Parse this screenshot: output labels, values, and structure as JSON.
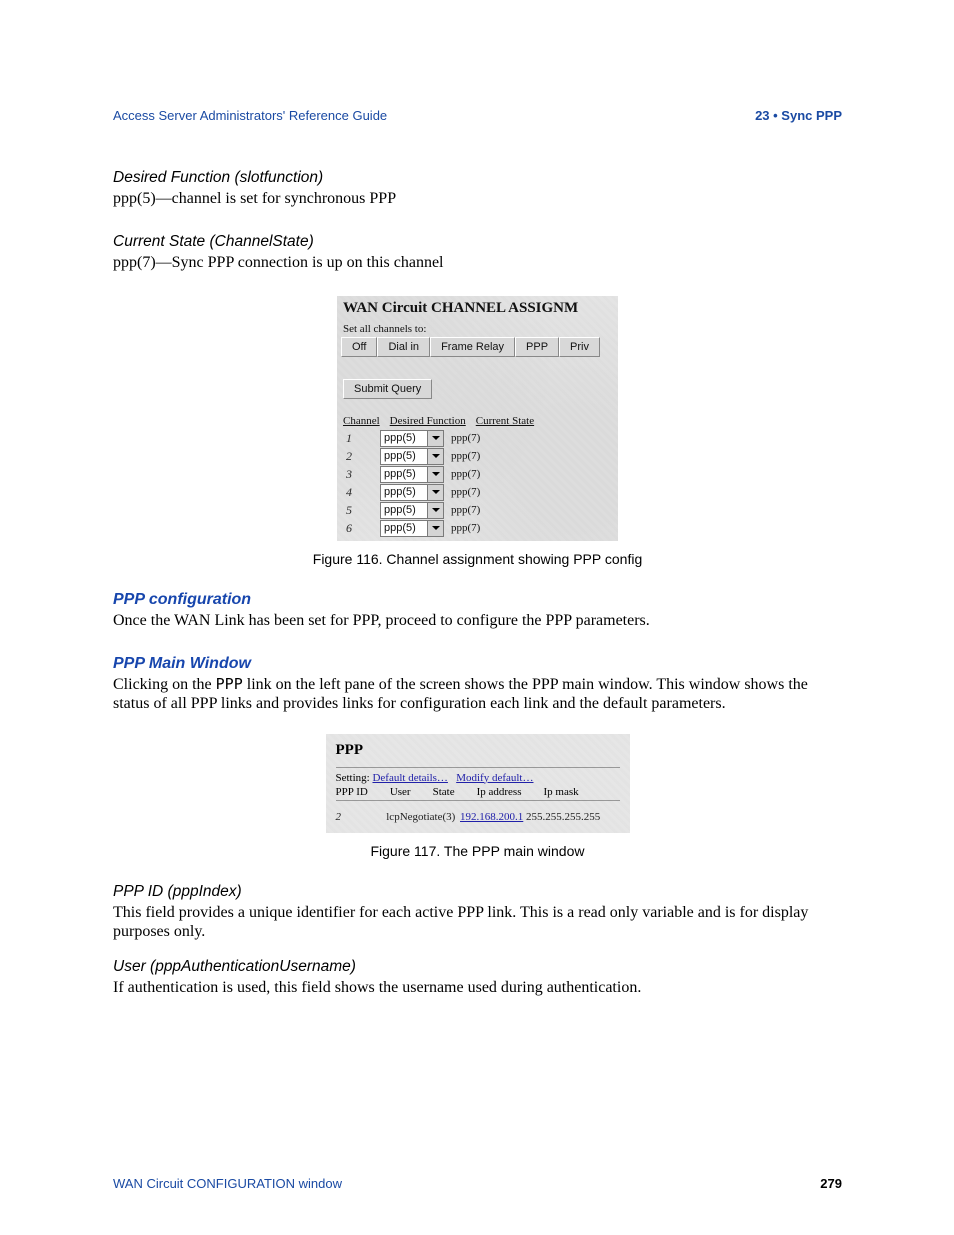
{
  "header": {
    "doc_title": "Access Server Administrators' Reference Guide",
    "chapter": "23 • Sync PPP"
  },
  "sec1": {
    "heading": "Desired Function (slotfunction)",
    "body": "ppp(5)—channel is set for synchronous PPP"
  },
  "sec2": {
    "heading": "Current State (ChannelState)",
    "body": "ppp(7)—Sync PPP connection is up on this channel"
  },
  "fig116": {
    "title": "WAN Circuit CHANNEL ASSIGNM",
    "set_label": "Set all channels to:",
    "buttons": [
      "Off",
      "Dial in",
      "Frame Relay",
      "PPP",
      "Priv"
    ],
    "submit": "Submit Query",
    "hdr": [
      "Channel",
      "Desired Function",
      "Current State"
    ],
    "rows": [
      {
        "ch": "1",
        "fn": "ppp(5)",
        "state": "ppp(7)"
      },
      {
        "ch": "2",
        "fn": "ppp(5)",
        "state": "ppp(7)"
      },
      {
        "ch": "3",
        "fn": "ppp(5)",
        "state": "ppp(7)"
      },
      {
        "ch": "4",
        "fn": "ppp(5)",
        "state": "ppp(7)"
      },
      {
        "ch": "5",
        "fn": "ppp(5)",
        "state": "ppp(7)"
      },
      {
        "ch": "6",
        "fn": "ppp(5)",
        "state": "ppp(7)"
      }
    ],
    "caption": "Figure 116. Channel assignment showing PPP config"
  },
  "ppp_config": {
    "title": "PPP configuration",
    "body": "Once the WAN Link has been set for PPP, proceed to configure the PPP parameters."
  },
  "ppp_main": {
    "title": "PPP Main Window",
    "body_a": "Clicking on the ",
    "body_link": "PPP",
    "body_b": " link on the left pane of the screen shows the PPP main window. This window shows the status of all PPP links and provides links for configuration each link and the default parameters."
  },
  "fig117": {
    "title": "PPP",
    "setting_label": "Setting:",
    "links": [
      "Default details…",
      "Modify default…"
    ],
    "cols": [
      "PPP ID",
      "User",
      "State",
      "Ip address",
      "Ip mask"
    ],
    "row": {
      "id": "2",
      "user": "",
      "state": "lcpNegotiate(3)",
      "ip": "192.168.200.1",
      "mask": "255.255.255.255"
    },
    "caption": "Figure 117. The PPP main window"
  },
  "sec_pppid": {
    "heading": "PPP ID (pppIndex)",
    "body": "This field provides a unique identifier for each active PPP link. This is a read only variable and is for display purposes only."
  },
  "sec_user": {
    "heading": "User (pppAuthenticationUsername)",
    "body": "If authentication is used, this field shows the username used during authentication."
  },
  "footer": {
    "left": "WAN Circuit CONFIGURATION window",
    "page": "279"
  }
}
